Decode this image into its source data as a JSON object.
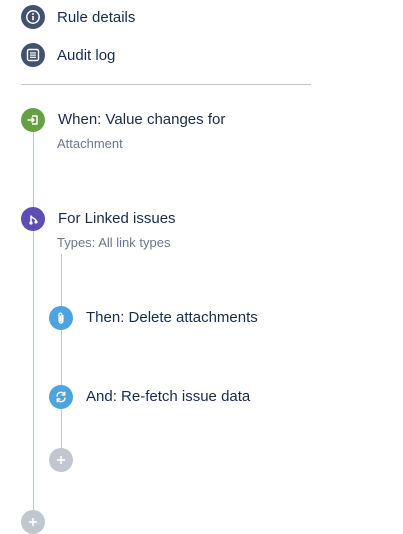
{
  "nav": {
    "rule_details": {
      "label": "Rule details",
      "icon": "info-icon"
    },
    "audit_log": {
      "label": "Audit log",
      "icon": "list-icon"
    }
  },
  "flow": {
    "trigger": {
      "title": "When: Value changes for",
      "subtitle": "Attachment",
      "icon": "trigger-icon",
      "color": "#65a144"
    },
    "branch": {
      "title": "For Linked issues",
      "subtitle": "Types: All link types",
      "icon": "branch-icon",
      "color": "#5e4db2"
    },
    "action_delete": {
      "title": "Then: Delete attachments",
      "icon": "paperclip-icon",
      "color": "#4ca3dd"
    },
    "action_refetch": {
      "title": "And: Re-fetch issue data",
      "icon": "refresh-icon",
      "color": "#4ca3dd"
    },
    "add_in_branch": {
      "icon": "plus-icon",
      "color": "#c1c7d0"
    },
    "add_main": {
      "icon": "plus-icon",
      "color": "#c1c7d0"
    }
  }
}
